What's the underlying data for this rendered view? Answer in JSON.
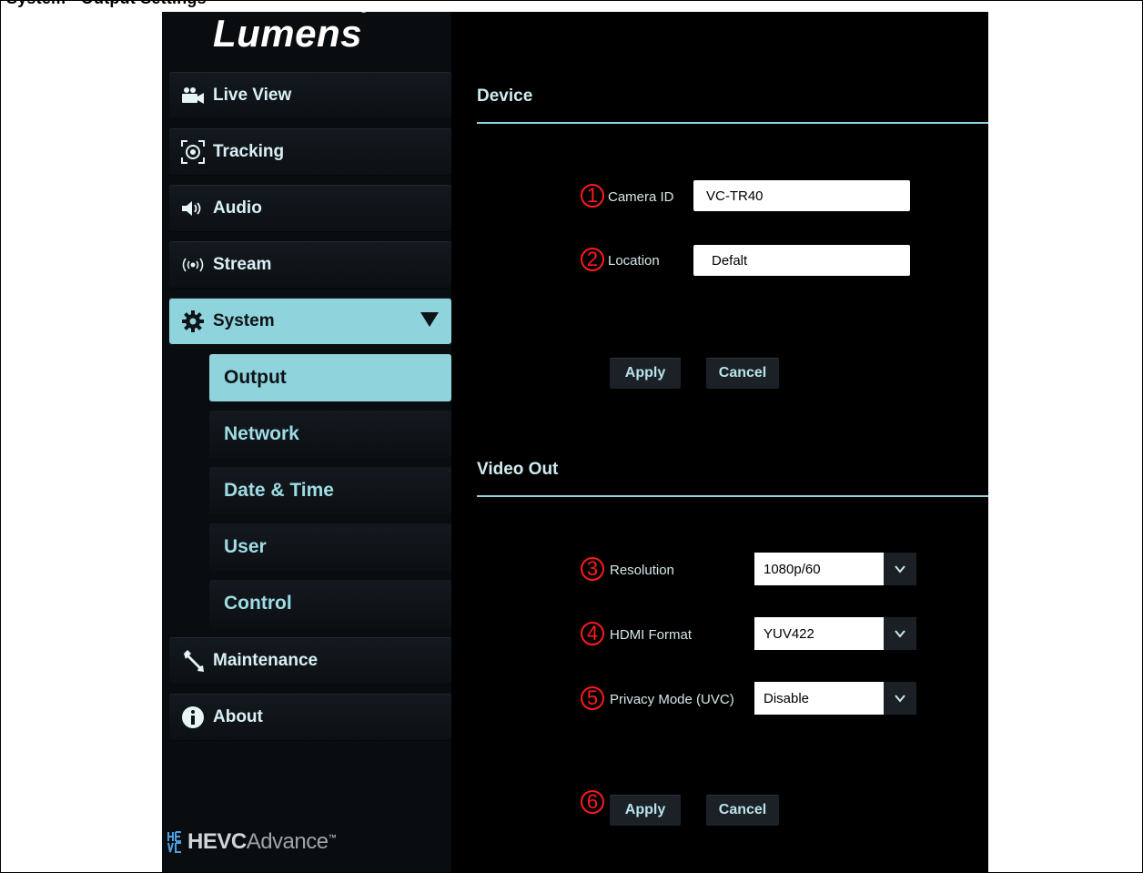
{
  "page_header": "System - Output Settings",
  "brand": {
    "logo": "Lumens",
    "registered": "®",
    "footer_logo": "HEVC",
    "footer_logo_light": "Advance",
    "footer_tm": "™"
  },
  "sidebar": {
    "items": [
      {
        "label": "Live View",
        "icon": "video-camera-icon"
      },
      {
        "label": "Tracking",
        "icon": "tracking-target-icon"
      },
      {
        "label": "Audio",
        "icon": "speaker-icon"
      },
      {
        "label": "Stream",
        "icon": "broadcast-icon"
      },
      {
        "label": "System",
        "icon": "gear-icon"
      },
      {
        "label": "Maintenance",
        "icon": "wrench-icon"
      },
      {
        "label": "About",
        "icon": "info-icon"
      }
    ],
    "sub_items": [
      {
        "label": "Output"
      },
      {
        "label": "Network"
      },
      {
        "label": "Date & Time"
      },
      {
        "label": "User"
      },
      {
        "label": "Control"
      }
    ]
  },
  "device": {
    "title": "Device",
    "camera_id_label": "Camera ID",
    "camera_id_value": "VC-TR40",
    "location_label": "Location",
    "location_value": "Defalt",
    "apply": "Apply",
    "cancel": "Cancel"
  },
  "video_out": {
    "title": "Video Out",
    "resolution_label": "Resolution",
    "resolution_value": "1080p/60",
    "hdmi_label": "HDMI Format",
    "hdmi_value": "YUV422",
    "privacy_label": "Privacy Mode (UVC)",
    "privacy_value": "Disable",
    "apply": "Apply",
    "cancel": "Cancel"
  },
  "markers": [
    "1",
    "2",
    "3",
    "4",
    "5",
    "6"
  ],
  "colors": {
    "accent": "#8fd3dc",
    "marker": "#ff1a1a",
    "background": "#000000"
  }
}
